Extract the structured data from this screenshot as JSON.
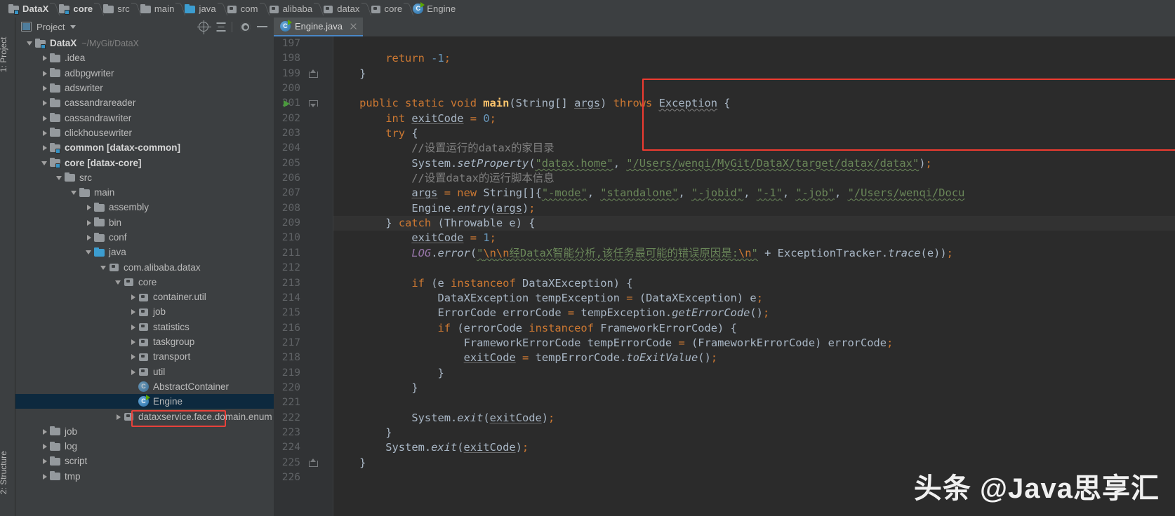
{
  "breadcrumb": [
    {
      "label": "DataX",
      "icon": "module-icon",
      "bold": true
    },
    {
      "label": "core",
      "icon": "module-icon",
      "bold": true
    },
    {
      "label": "src",
      "icon": "folder-icon",
      "bold": false
    },
    {
      "label": "main",
      "icon": "folder-icon",
      "bold": false
    },
    {
      "label": "java",
      "icon": "source-folder-icon",
      "bold": false
    },
    {
      "label": "com",
      "icon": "package-icon",
      "bold": false
    },
    {
      "label": "alibaba",
      "icon": "package-icon",
      "bold": false
    },
    {
      "label": "datax",
      "icon": "package-icon",
      "bold": false
    },
    {
      "label": "core",
      "icon": "package-icon",
      "bold": false
    },
    {
      "label": "Engine",
      "icon": "java-class-icon",
      "bold": false
    }
  ],
  "left_strip": {
    "project_tab": "1: Project",
    "structure_tab": "2: Structure"
  },
  "project_panel": {
    "title": "Project",
    "caret": "chevron-down-icon",
    "buttons": [
      "locate-icon",
      "collapse-all-icon",
      "settings-icon",
      "hide-icon"
    ],
    "tree": [
      {
        "indent": 0,
        "arrow": "down",
        "icon": "module-icon",
        "label": "DataX",
        "bold": true,
        "path": "~/MyGit/DataX"
      },
      {
        "indent": 1,
        "arrow": "right",
        "icon": "folder-icon",
        "label": ".idea"
      },
      {
        "indent": 1,
        "arrow": "right",
        "icon": "folder-icon",
        "label": "adbpgwriter"
      },
      {
        "indent": 1,
        "arrow": "right",
        "icon": "folder-icon",
        "label": "adswriter"
      },
      {
        "indent": 1,
        "arrow": "right",
        "icon": "folder-icon",
        "label": "cassandrareader"
      },
      {
        "indent": 1,
        "arrow": "right",
        "icon": "folder-icon",
        "label": "cassandrawriter"
      },
      {
        "indent": 1,
        "arrow": "right",
        "icon": "folder-icon",
        "label": "clickhousewriter"
      },
      {
        "indent": 1,
        "arrow": "right",
        "icon": "module-icon",
        "label": "common [datax-common]",
        "bold": true
      },
      {
        "indent": 1,
        "arrow": "down",
        "icon": "module-icon",
        "label": "core [datax-core]",
        "bold": true
      },
      {
        "indent": 2,
        "arrow": "down",
        "icon": "folder-icon",
        "label": "src"
      },
      {
        "indent": 3,
        "arrow": "down",
        "icon": "folder-icon",
        "label": "main"
      },
      {
        "indent": 4,
        "arrow": "right",
        "icon": "folder-icon",
        "label": "assembly"
      },
      {
        "indent": 4,
        "arrow": "right",
        "icon": "folder-icon",
        "label": "bin"
      },
      {
        "indent": 4,
        "arrow": "right",
        "icon": "folder-icon",
        "label": "conf"
      },
      {
        "indent": 4,
        "arrow": "down",
        "icon": "source-folder-icon",
        "label": "java"
      },
      {
        "indent": 5,
        "arrow": "down",
        "icon": "package-icon",
        "label": "com.alibaba.datax"
      },
      {
        "indent": 6,
        "arrow": "down",
        "icon": "package-icon",
        "label": "core"
      },
      {
        "indent": 7,
        "arrow": "right",
        "icon": "package-icon",
        "label": "container.util"
      },
      {
        "indent": 7,
        "arrow": "right",
        "icon": "package-icon",
        "label": "job"
      },
      {
        "indent": 7,
        "arrow": "right",
        "icon": "package-icon",
        "label": "statistics"
      },
      {
        "indent": 7,
        "arrow": "right",
        "icon": "package-icon",
        "label": "taskgroup"
      },
      {
        "indent": 7,
        "arrow": "right",
        "icon": "package-icon",
        "label": "transport"
      },
      {
        "indent": 7,
        "arrow": "right",
        "icon": "package-icon",
        "label": "util"
      },
      {
        "indent": 7,
        "arrow": "none",
        "icon": "abstract-class-icon",
        "label": "AbstractContainer"
      },
      {
        "indent": 7,
        "arrow": "none",
        "icon": "runnable-class-icon",
        "label": "Engine",
        "selected": true,
        "highlighted": true
      },
      {
        "indent": 6,
        "arrow": "right",
        "icon": "package-icon",
        "label": "dataxservice.face.domain.enum"
      },
      {
        "indent": 1,
        "arrow": "right",
        "icon": "folder-icon",
        "label": "job"
      },
      {
        "indent": 1,
        "arrow": "right",
        "icon": "folder-icon",
        "label": "log"
      },
      {
        "indent": 1,
        "arrow": "right",
        "icon": "folder-icon",
        "label": "script"
      },
      {
        "indent": 1,
        "arrow": "right",
        "icon": "folder-icon",
        "label": "tmp"
      }
    ]
  },
  "editor": {
    "tab": {
      "label": "Engine.java",
      "icon": "runnable-class-icon",
      "close": "close-icon"
    },
    "first_line_number": 197,
    "line_count": 30,
    "gutter": {
      "run_marker_line": 201,
      "fold_open_lines": [
        201
      ],
      "fold_close_lines": [
        199,
        225
      ]
    },
    "lines": [
      {
        "n": 197,
        "text": ""
      },
      {
        "n": 198,
        "text": "        return -1;"
      },
      {
        "n": 199,
        "text": "    }"
      },
      {
        "n": 200,
        "text": ""
      },
      {
        "n": 201,
        "text": "    public static void main(String[] args) throws Exception {"
      },
      {
        "n": 202,
        "text": "        int exitCode = 0;"
      },
      {
        "n": 203,
        "text": "        try {"
      },
      {
        "n": 204,
        "text": "            //设置运行的datax的家目录"
      },
      {
        "n": 205,
        "text": "            System.setProperty(\"datax.home\", \"/Users/wenqi/MyGit/DataX/target/datax/datax\");"
      },
      {
        "n": 206,
        "text": "            //设置datax的运行脚本信息"
      },
      {
        "n": 207,
        "text": "            args = new String[]{\"-mode\", \"standalone\", \"-jobid\", \"-1\", \"-job\", \"/Users/wenqi/Docu"
      },
      {
        "n": 208,
        "text": "            Engine.entry(args);"
      },
      {
        "n": 209,
        "text": "        } catch (Throwable e) {"
      },
      {
        "n": 210,
        "text": "            exitCode = 1;"
      },
      {
        "n": 211,
        "text": "            LOG.error(\"\\n\\n经DataX智能分析,该任务最可能的错误原因是:\\n\" + ExceptionTracker.trace(e));"
      },
      {
        "n": 212,
        "text": ""
      },
      {
        "n": 213,
        "text": "            if (e instanceof DataXException) {"
      },
      {
        "n": 214,
        "text": "                DataXException tempException = (DataXException) e;"
      },
      {
        "n": 215,
        "text": "                ErrorCode errorCode = tempException.getErrorCode();"
      },
      {
        "n": 216,
        "text": "                if (errorCode instanceof FrameworkErrorCode) {"
      },
      {
        "n": 217,
        "text": "                    FrameworkErrorCode tempErrorCode = (FrameworkErrorCode) errorCode;"
      },
      {
        "n": 218,
        "text": "                    exitCode = tempErrorCode.toExitValue();"
      },
      {
        "n": 219,
        "text": "                }"
      },
      {
        "n": 220,
        "text": "            }"
      },
      {
        "n": 221,
        "text": ""
      },
      {
        "n": 222,
        "text": "            System.exit(exitCode);"
      },
      {
        "n": 223,
        "text": "        }"
      },
      {
        "n": 224,
        "text": "        System.exit(exitCode);"
      },
      {
        "n": 225,
        "text": "    }"
      },
      {
        "n": 226,
        "text": ""
      }
    ]
  },
  "annotations": {
    "code_highlight_note": "red rectangle around lines 203-208 code block",
    "tree_highlight_note": "red rectangle around Engine tree node"
  },
  "watermark": "头条 @Java思享汇",
  "colors": {
    "editor_bg": "#2b2b2b",
    "gutter_bg": "#313335",
    "panel_bg": "#3c3f41",
    "accent": "#4a88c7",
    "selection": "#0d293e",
    "highlight_red": "#ef3b30",
    "string_green": "#6a8759",
    "keyword_orange": "#cc7832",
    "number_blue": "#6897bb",
    "comment_gray": "#808080",
    "field_purple": "#9876aa",
    "text_default": "#a9b7c6"
  }
}
